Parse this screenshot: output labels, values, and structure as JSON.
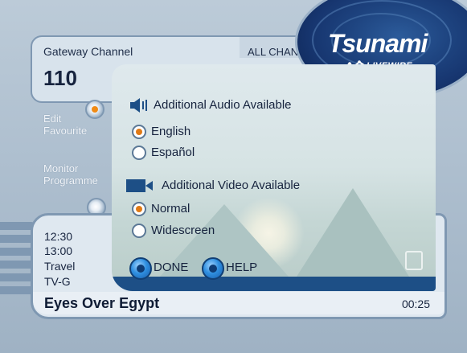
{
  "header": {
    "gateway_label": "Gateway Channel",
    "channel_number": "110",
    "all_channels": "ALL CHAN"
  },
  "logo": {
    "name": "Tsunami",
    "sub": "LIVEWIRE"
  },
  "side_menu": {
    "edit_favourite": [
      "Edit",
      "Favourite"
    ],
    "monitor_programme": [
      "Monitor",
      "Programme"
    ]
  },
  "programme": {
    "time_start": "12:30",
    "time_end": "13:00",
    "genre": "Travel",
    "rating": "TV-G",
    "title": "Eyes Over Egypt",
    "remaining": "00:25"
  },
  "dialog": {
    "audio_section": "Additional Audio Available",
    "audio_options": [
      {
        "label": "English",
        "selected": true
      },
      {
        "label": "Español",
        "selected": false
      }
    ],
    "video_section": "Additional Video Available",
    "video_options": [
      {
        "label": "Normal",
        "selected": true
      },
      {
        "label": "Widescreen",
        "selected": false
      }
    ],
    "done_label": "DONE",
    "help_label": "HELP"
  },
  "icons": {
    "audio": "speaker-icon",
    "video": "video-camera-icon"
  },
  "colors": {
    "accent_blue": "#1d4f86",
    "selected_orange": "#e07a16"
  }
}
